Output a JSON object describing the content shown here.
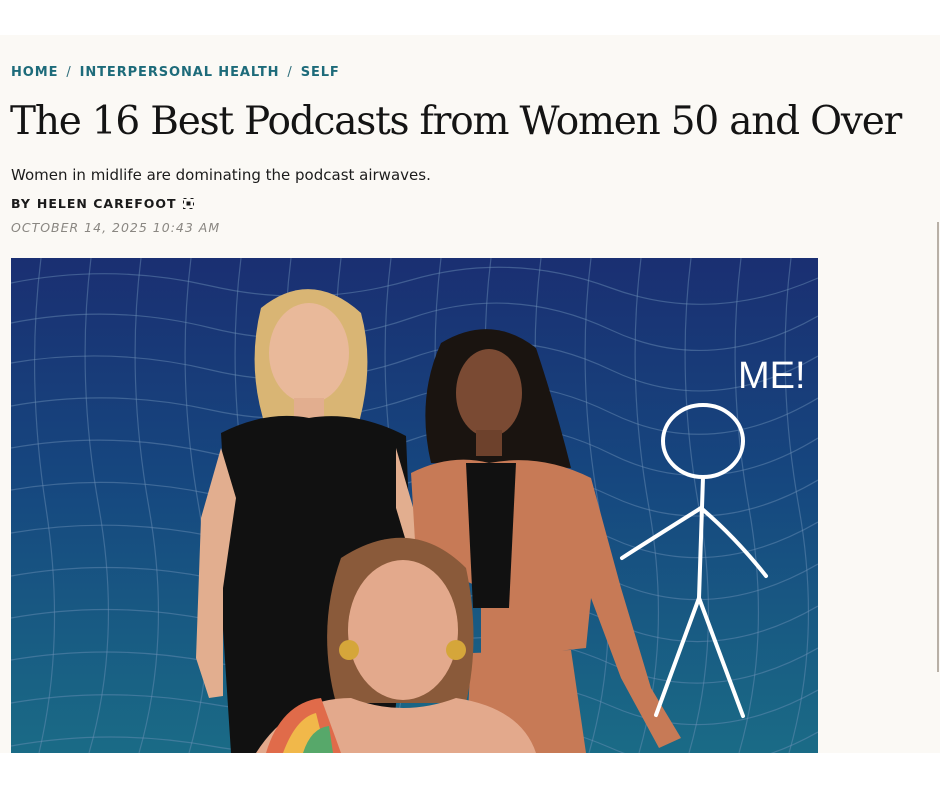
{
  "breadcrumb": {
    "items": [
      {
        "label": "HOME"
      },
      {
        "label": "INTERPERSONAL HEALTH"
      },
      {
        "label": "SELF"
      }
    ],
    "separator": "/"
  },
  "article": {
    "title": "The 16 Best Podcasts from Women 50 and Over",
    "dek": "Women in midlife are dominating the podcast airwaves.",
    "byline_prefix": "BY",
    "author": "HELEN CAREFOOT",
    "date": "OCTOBER 14, 2025 10:43 AM"
  },
  "hero": {
    "annotation": "ME!",
    "icons": [
      "grid-wave-background",
      "stick-figure-icon",
      "expand-icon"
    ]
  },
  "colors": {
    "breadcrumb": "#1d6b7a",
    "title": "#141414",
    "date": "#8a8782",
    "page_bg": "#fbf9f5",
    "hero_top": "#1a2f72",
    "hero_bottom": "#1a6b86",
    "jacket": "#c77a56"
  }
}
